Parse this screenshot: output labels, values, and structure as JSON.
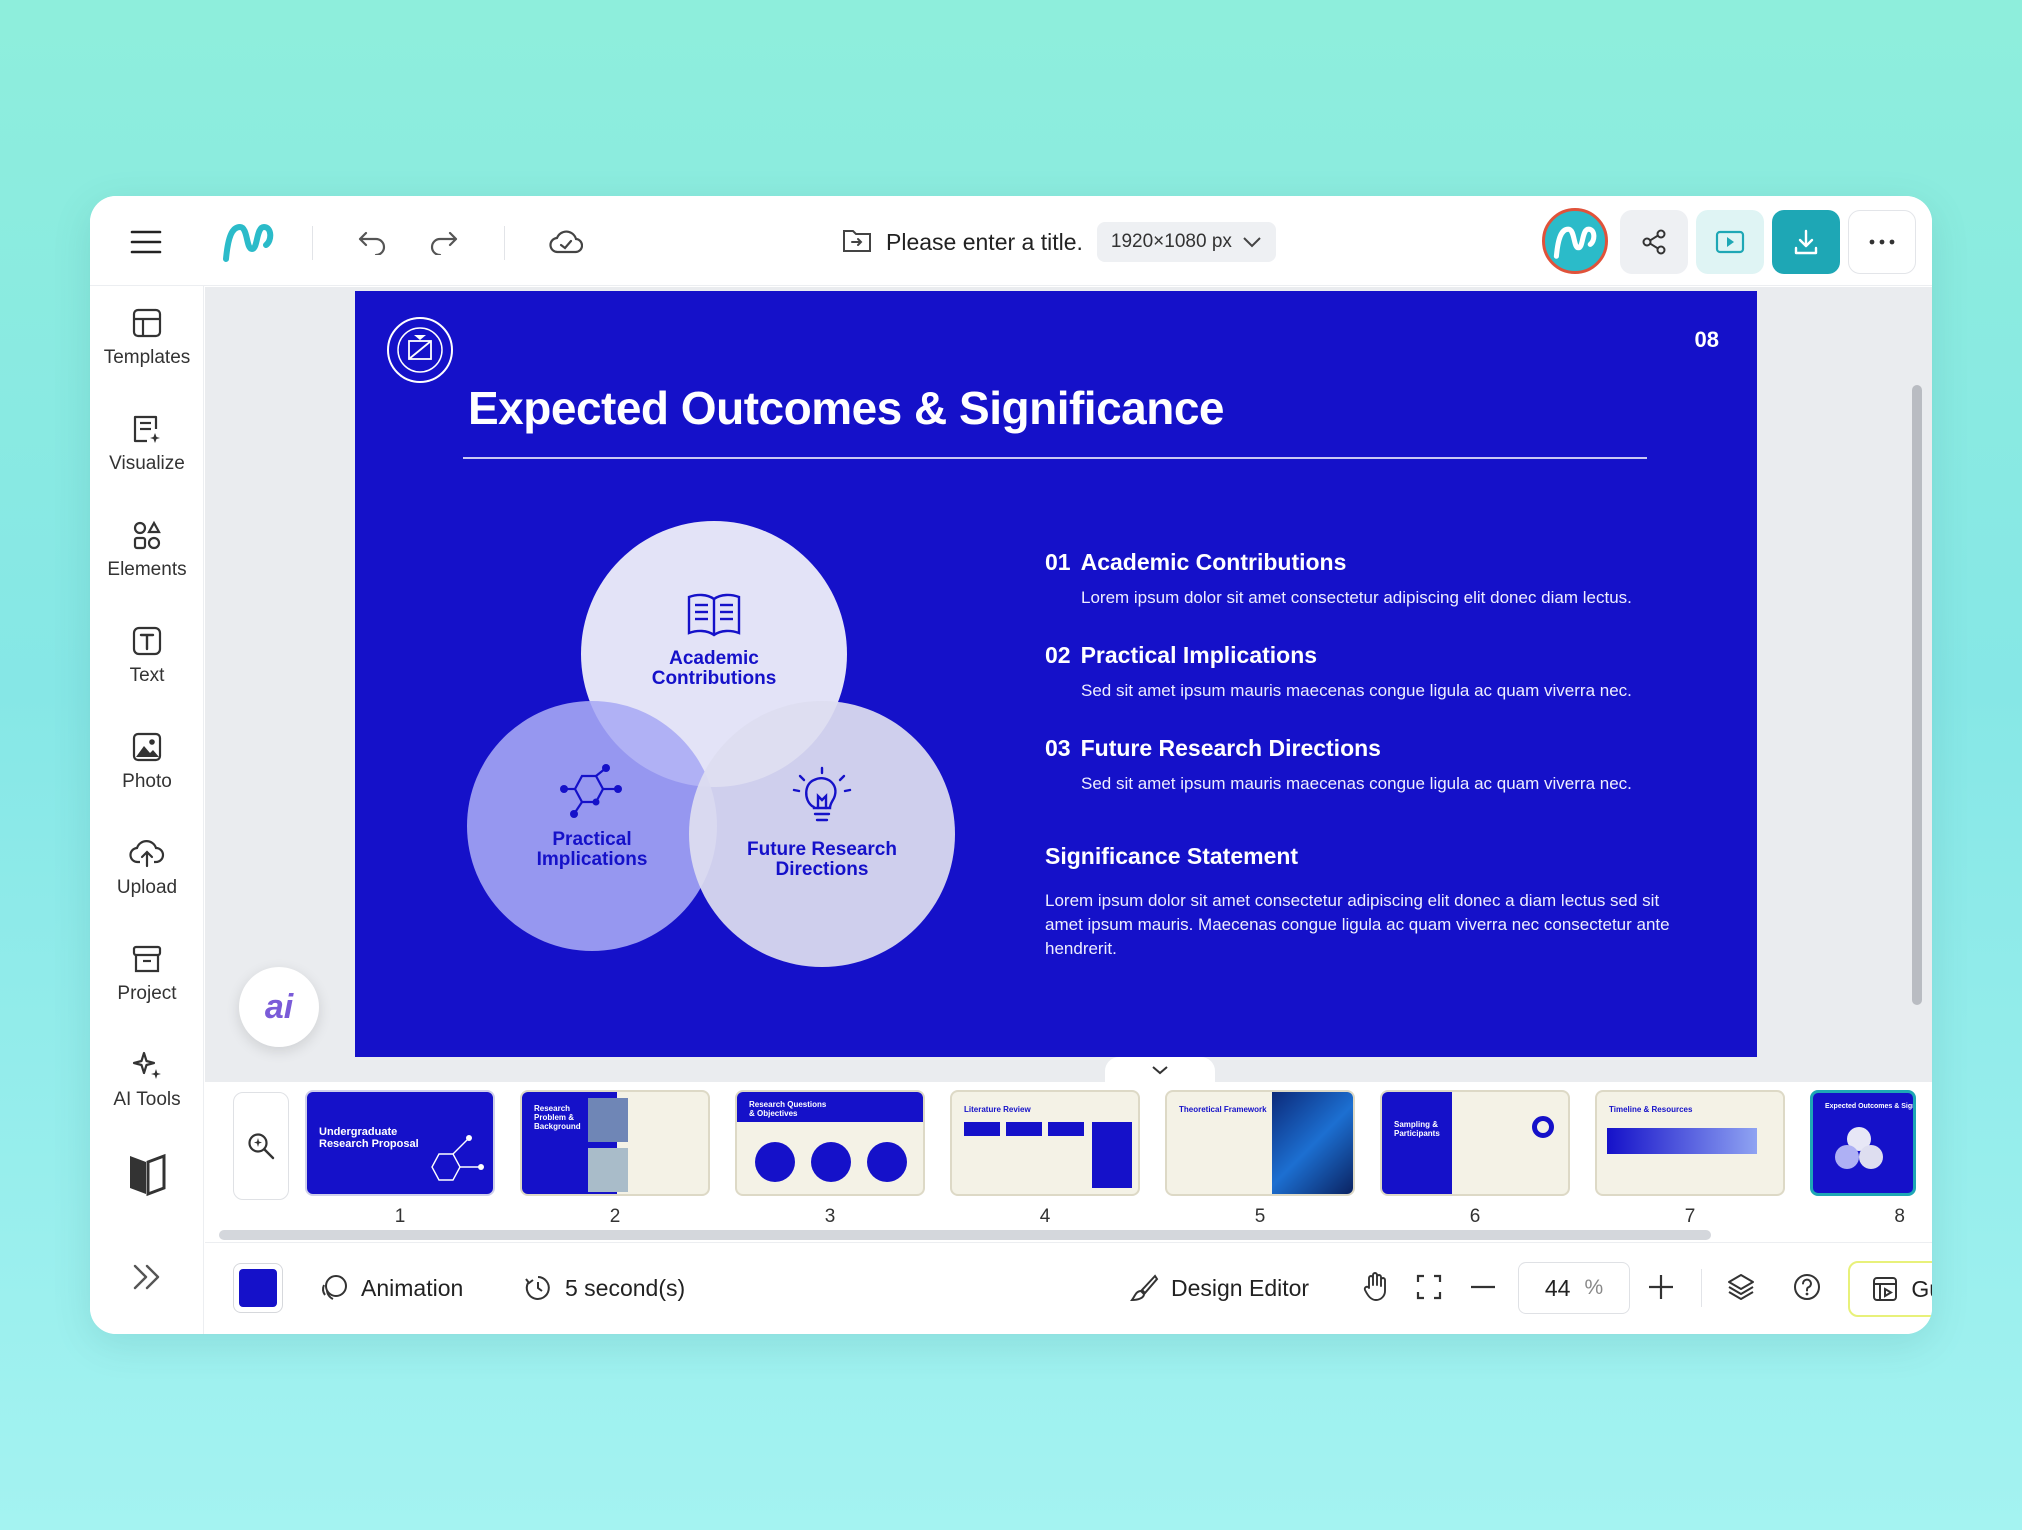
{
  "toolbar": {
    "doc_title": "Please enter a title.",
    "canvas_size": "1920×1080 px"
  },
  "sidebar": {
    "items": [
      {
        "label": "Templates"
      },
      {
        "label": "Visualize"
      },
      {
        "label": "Elements"
      },
      {
        "label": "Text"
      },
      {
        "label": "Photo"
      },
      {
        "label": "Upload"
      },
      {
        "label": "Project"
      },
      {
        "label": "AI Tools"
      }
    ]
  },
  "slide": {
    "page_number": "08",
    "title": "Expected Outcomes & Significance",
    "venn": {
      "top": "Academic Contributions",
      "left": "Practical Implications",
      "right": "Future Research Directions"
    },
    "items": [
      {
        "num": "01",
        "title": "Academic Contributions",
        "desc": "Lorem ipsum dolor sit amet consectetur adipiscing elit donec diam lectus."
      },
      {
        "num": "02",
        "title": "Practical Implications",
        "desc": "Sed sit amet ipsum mauris maecenas congue ligula ac quam viverra nec."
      },
      {
        "num": "03",
        "title": "Future Research Directions",
        "desc": "Sed sit amet ipsum mauris maecenas congue ligula ac quam viverra nec."
      }
    ],
    "significance_title": "Significance Statement",
    "significance_text": "Lorem ipsum dolor sit amet consectetur adipiscing elit donec a diam lectus sed sit amet ipsum mauris. Maecenas congue ligula ac quam viverra nec consectetur ante hendrerit."
  },
  "ai_button": "ai",
  "filmstrip": {
    "thumbnails": [
      {
        "num": "1",
        "caption": "Undergraduate Research Proposal"
      },
      {
        "num": "2",
        "caption": "Research Problem & Background"
      },
      {
        "num": "3",
        "caption": "Research Questions & Objectives"
      },
      {
        "num": "4",
        "caption": "Literature Review"
      },
      {
        "num": "5",
        "caption": "Theoretical Framework"
      },
      {
        "num": "6",
        "caption": "Sampling & Participants"
      },
      {
        "num": "7",
        "caption": "Timeline & Resources"
      },
      {
        "num": "8",
        "caption": "Expected Outcomes & Significance"
      }
    ]
  },
  "bottombar": {
    "swatch_color": "#1511c9",
    "animation_label": "Animation",
    "duration_label": "5 second(s)",
    "design_editor_label": "Design Editor",
    "zoom_value": "44",
    "zoom_unit": "%",
    "guide_label": "Guide"
  },
  "colors": {
    "slide_bg": "#1511c9",
    "accent": "#1ea7b5",
    "avatar_ring": "#e0523a"
  }
}
